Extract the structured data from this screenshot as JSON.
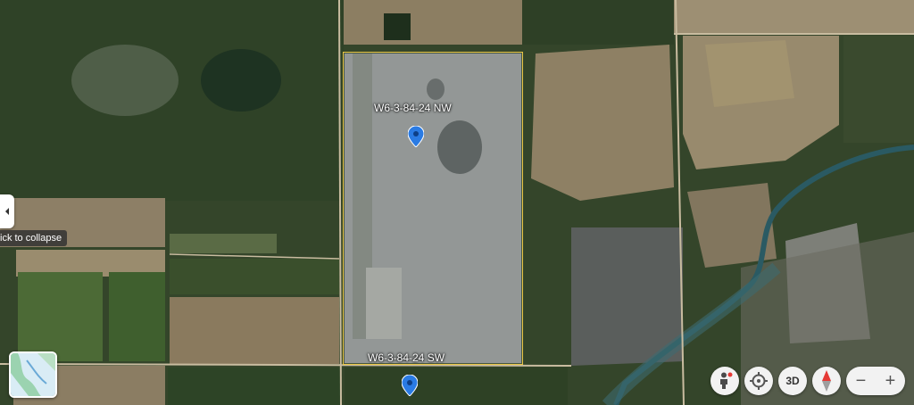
{
  "parcels": [
    {
      "label": "W6-3-84-24 NW"
    },
    {
      "label": "W6-3-84-24 SW"
    }
  ],
  "sidebar": {
    "collapse_tooltip": "ick to collapse"
  },
  "controls": {
    "three_d_label": "3D",
    "zoom_out_label": "−",
    "zoom_in_label": "+"
  },
  "icons": {
    "pin": "map-pin-icon",
    "street_view": "street-view-icon",
    "locate": "locate-icon",
    "compass": "compass-icon",
    "collapse": "chevron-left-icon"
  },
  "colors": {
    "parcel_border": "#e8c547",
    "pin": "#2a7be4",
    "compass_red": "#e53935"
  }
}
